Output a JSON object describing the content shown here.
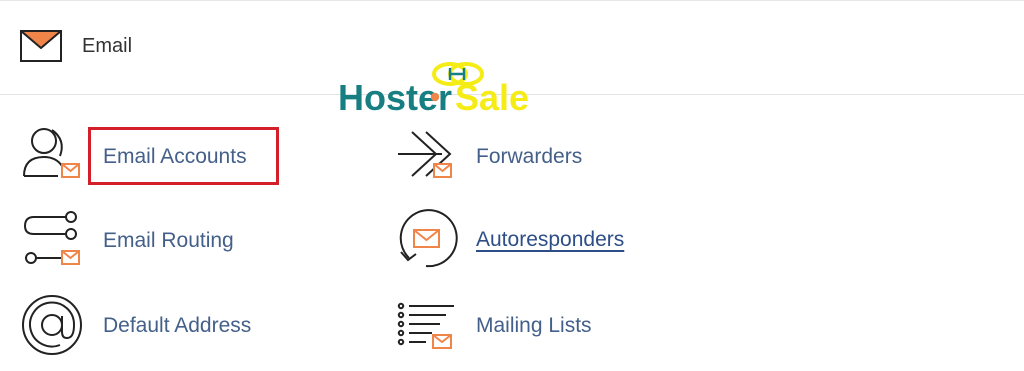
{
  "header": {
    "title": "Email",
    "icon": "envelope-icon"
  },
  "watermark": {
    "text": "HosterSale",
    "logo_initials": "HS"
  },
  "items": [
    {
      "label": "Email Accounts",
      "icon": "email-accounts-icon",
      "link": false,
      "highlighted": true
    },
    {
      "label": "Forwarders",
      "icon": "forwarders-icon",
      "link": false
    },
    {
      "label": "Email Routing",
      "icon": "email-routing-icon",
      "link": false
    },
    {
      "label": "Autoresponders",
      "icon": "autoresponders-icon",
      "link": true
    },
    {
      "label": "Default Address",
      "icon": "at-sign-icon",
      "link": false
    },
    {
      "label": "Mailing Lists",
      "icon": "mailing-lists-icon",
      "link": false
    }
  ],
  "colors": {
    "label": "#44608a",
    "link": "#2d4e86",
    "accent": "#f0854a",
    "highlight": "#d31f2a",
    "watermark_teal": "#177f82",
    "watermark_yellow": "#f4ec14"
  }
}
